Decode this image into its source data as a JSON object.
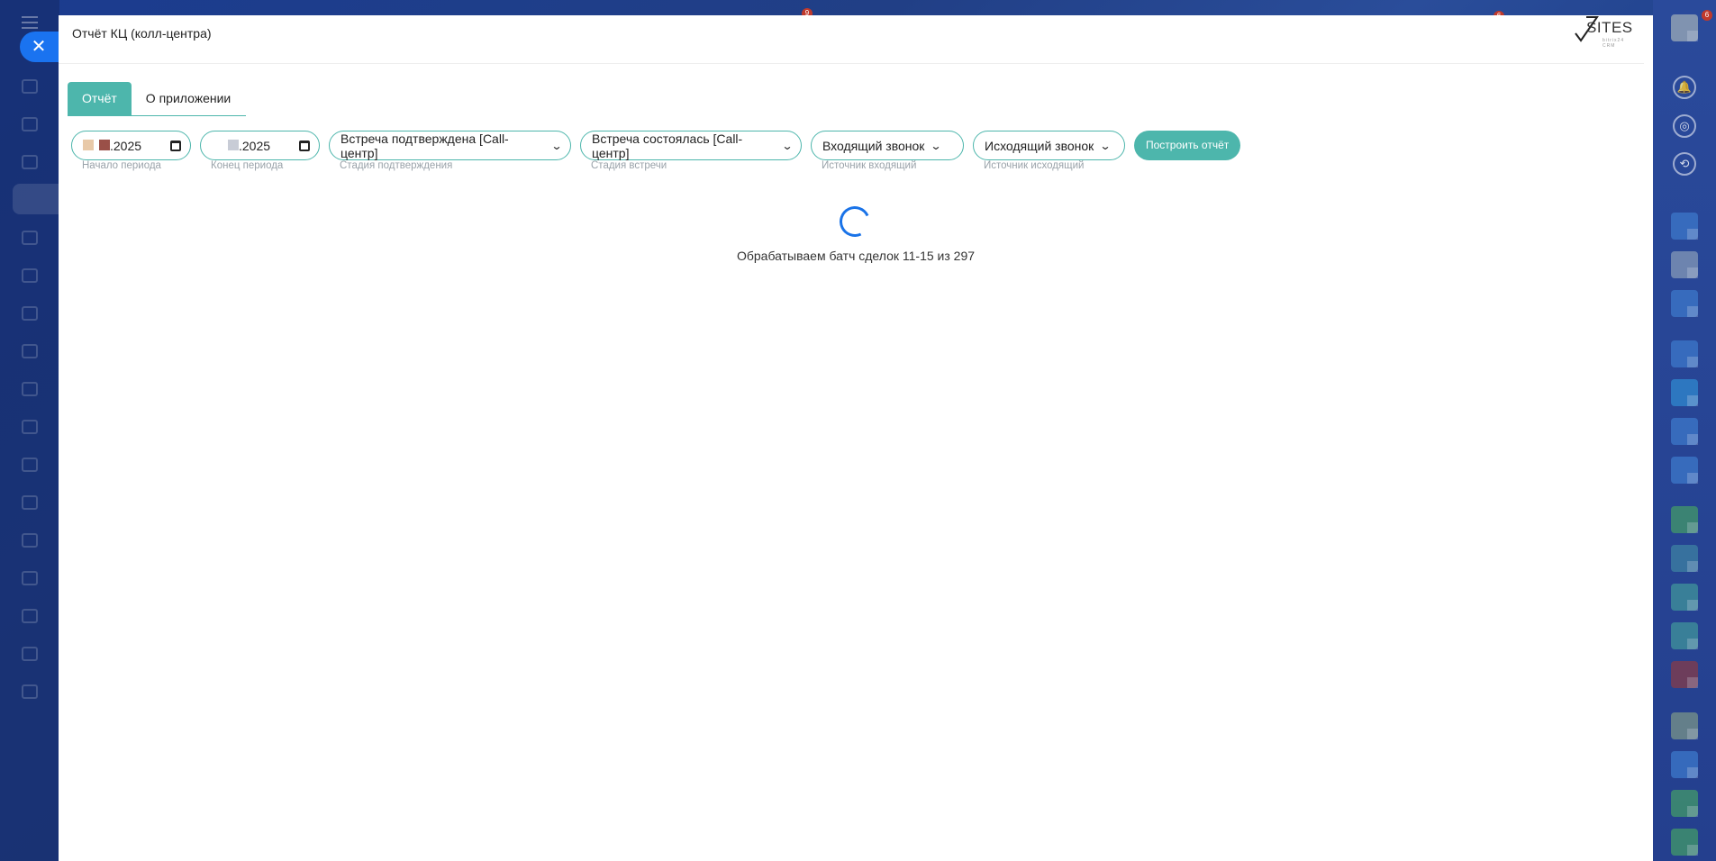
{
  "modal": {
    "title": "Отчёт КЦ (колл-центра)",
    "logo_text": "SITES",
    "logo_sub": "bitrix24 CRM"
  },
  "tabs": [
    {
      "label": "Отчёт",
      "active": true
    },
    {
      "label": "О приложении",
      "active": false
    }
  ],
  "filters": {
    "start_date": {
      "value": ".2025",
      "hint": "Начало периода"
    },
    "end_date": {
      "value": ".2025",
      "hint": "Конец периода"
    },
    "confirm_stage": {
      "value": "Встреча подтверждена [Call-центр]",
      "hint": "Стадия подтверждения"
    },
    "meeting_stage": {
      "value": "Встреча состоялась [Call-центр]",
      "hint": "Стадия встречи"
    },
    "incoming_source": {
      "value": "Входящий звонок",
      "hint": "Источник входящий"
    },
    "outgoing_source": {
      "value": "Исходящий звонок",
      "hint": "Источник исходящий"
    },
    "build_button": "Построить отчёт"
  },
  "status": {
    "text": "Обрабатываем батч сделок 11-15 из 297"
  },
  "colors": {
    "accent": "#4db6ac",
    "spinner": "#1a73e8",
    "close_button": "#1a73f0"
  },
  "icons": {
    "close": "close-icon",
    "calendar": "calendar-icon",
    "chevron": "chevron-down-icon",
    "bell": "bell-icon"
  },
  "badges": {
    "top_1": "9",
    "top_2": "6",
    "top_3": "6"
  }
}
